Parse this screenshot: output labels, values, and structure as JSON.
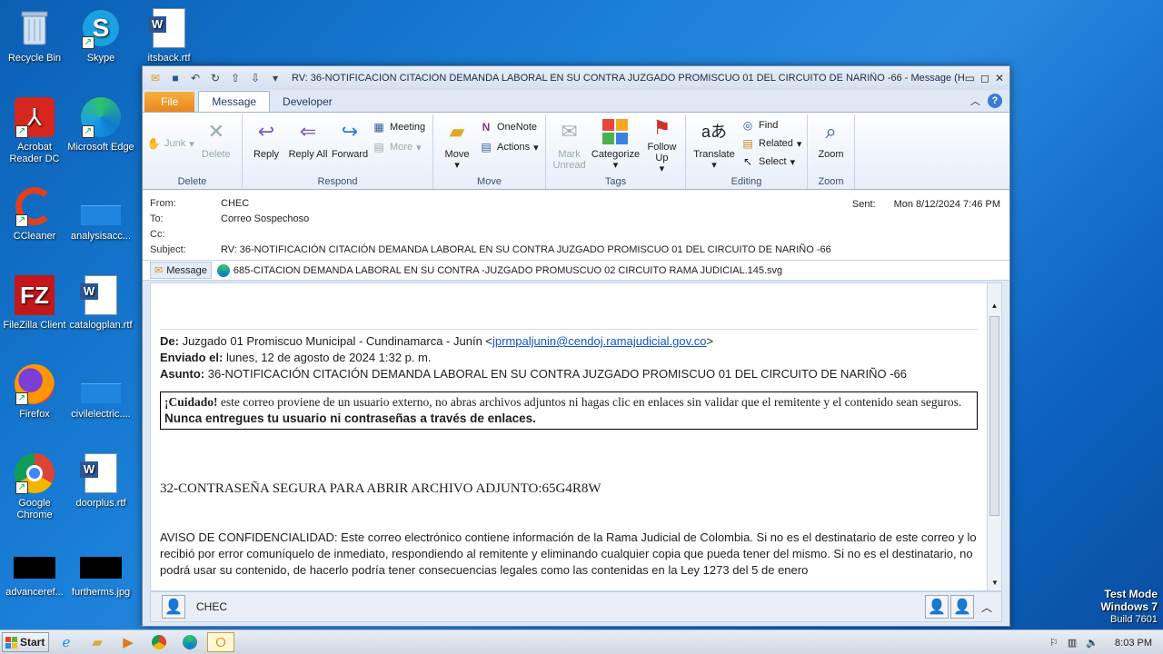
{
  "desktop": {
    "icons": [
      {
        "label": "Recycle Bin",
        "icon": "recycle-bin-icon"
      },
      {
        "label": "Skype",
        "icon": "skype-icon"
      },
      {
        "label": "itsback.rtf",
        "icon": "word-document-icon"
      },
      {
        "label": "Acrobat Reader DC",
        "icon": "acrobat-icon"
      },
      {
        "label": "Microsoft Edge",
        "icon": "edge-icon"
      },
      {
        "label": "CCleaner",
        "icon": "ccleaner-icon"
      },
      {
        "label": "analysisacc...",
        "icon": "blank-file-icon"
      },
      {
        "label": "FileZilla Client",
        "icon": "filezilla-icon"
      },
      {
        "label": "catalogplan.rtf",
        "icon": "word-document-icon"
      },
      {
        "label": "Firefox",
        "icon": "firefox-icon"
      },
      {
        "label": "civilelectric....",
        "icon": "blank-file-icon"
      },
      {
        "label": "Google Chrome",
        "icon": "chrome-icon"
      },
      {
        "label": "doorplus.rtf",
        "icon": "word-document-icon"
      },
      {
        "label": "advanceref...",
        "icon": "black-thumbnail-icon"
      },
      {
        "label": "furtherms.jpg",
        "icon": "black-thumbnail-icon"
      }
    ]
  },
  "window": {
    "title": "RV: 36-NOTIFICACIÓN CITACIÓN DEMANDA LABORAL EN SU CONTRA JUZGADO PROMISCUO 01 DEL CIRCUITO DE NARIÑO -66  -  Message (H...",
    "tabs": {
      "file": "File",
      "message": "Message",
      "developer": "Developer"
    },
    "ribbon": {
      "delete": {
        "junk": "Junk",
        "delete": "Delete",
        "label": "Delete"
      },
      "respond": {
        "reply": "Reply",
        "reply_all": "Reply All",
        "forward": "Forward",
        "meeting": "Meeting",
        "more": "More",
        "label": "Respond"
      },
      "move": {
        "move": "Move",
        "onenote": "OneNote",
        "actions": "Actions",
        "label": "Move"
      },
      "tags": {
        "mark_unread": "Mark Unread",
        "categorize": "Categorize",
        "follow_up": "Follow Up",
        "label": "Tags"
      },
      "editing": {
        "translate": "Translate",
        "find": "Find",
        "related": "Related",
        "select": "Select",
        "label": "Editing"
      },
      "zoom": {
        "zoom": "Zoom",
        "label": "Zoom"
      }
    },
    "header": {
      "from_label": "From:",
      "from": "CHEC",
      "to_label": "To:",
      "to": "Correo Sospechoso",
      "cc_label": "Cc:",
      "subject_label": "Subject:",
      "subject": "RV: 36-NOTIFICACIÓN CITACIÓN DEMANDA LABORAL EN SU CONTRA JUZGADO PROMISCUO 01 DEL CIRCUITO DE NARIÑO -66",
      "sent_label": "Sent:",
      "sent": "Mon 8/12/2024 7:46 PM"
    },
    "attachments": {
      "message_tab": "Message",
      "file": "685-CITACION DEMANDA LABORAL EN SU CONTRA -JUZGADO  PROMUSCUO  02  CIRCUITO  RAMA JUDICIAL.145.svg"
    },
    "body": {
      "de_label": "De:",
      "de_text": "Juzgado 01 Promiscuo Municipal - Cundinamarca - Junín <",
      "de_email": "jprmpaljunin@cendoj.ramajudicial.gov.co",
      "de_close": ">",
      "enviado_label": "Enviado el:",
      "enviado": "lunes, 12 de agosto de 2024 1:32 p. m.",
      "asunto_label": "Asunto:",
      "asunto": "36-NOTIFICACIÓN CITACIÓN DEMANDA LABORAL EN SU CONTRA JUZGADO PROMISCUO 01 DEL CIRCUITO DE NARIÑO -66",
      "warn_bold": "¡Cuidado!",
      "warn_text": " este correo proviene de un usuario externo, no abras archivos adjuntos ni hagas clic en enlaces sin validar que el remitente y el contenido sean seguros. ",
      "warn_bold2": "Nunca entregues tu usuario ni contraseñas a través de enlaces.",
      "password_line": "32-CONTRASEÑA SEGURA PARA ABRIR ARCHIVO ADJUNTO:65G4R8W",
      "confidential": "AVISO DE CONFIDENCIALIDAD: Este correo electrónico contiene información de la Rama Judicial de Colombia. Si no es el destinatario de este correo y lo recibió por error comuníquelo de inmediato, respondiendo al remitente y eliminando cualquier copia que pueda tener del mismo. Si no es el destinatario, no podrá usar su contenido, de hacerlo podría tener consecuencias legales como las contenidas en la Ley 1273 del 5 de enero"
    },
    "footer": {
      "sender": "CHEC"
    }
  },
  "taskbar": {
    "start": "Start",
    "time": "8:03 PM"
  },
  "watermark": {
    "line1": "Test Mode",
    "line2": "Windows 7",
    "line3": "Build 7601"
  }
}
